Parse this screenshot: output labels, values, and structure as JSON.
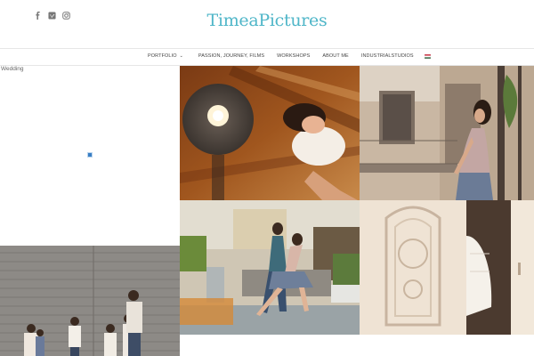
{
  "header": {
    "logo": "TimeaPictures",
    "social": [
      {
        "name": "facebook-icon"
      },
      {
        "name": "vimeo-icon"
      },
      {
        "name": "instagram-icon"
      }
    ]
  },
  "nav": {
    "items": [
      {
        "label": "Portfolio"
      },
      {
        "label": "Passion, Journey, Films"
      },
      {
        "label": "Workshops"
      },
      {
        "label": "About me"
      },
      {
        "label": "Industrialstudios"
      }
    ],
    "language_flag": "hungarian-flag-icon"
  },
  "gallery": {
    "wedding_label": "Wedding"
  }
}
